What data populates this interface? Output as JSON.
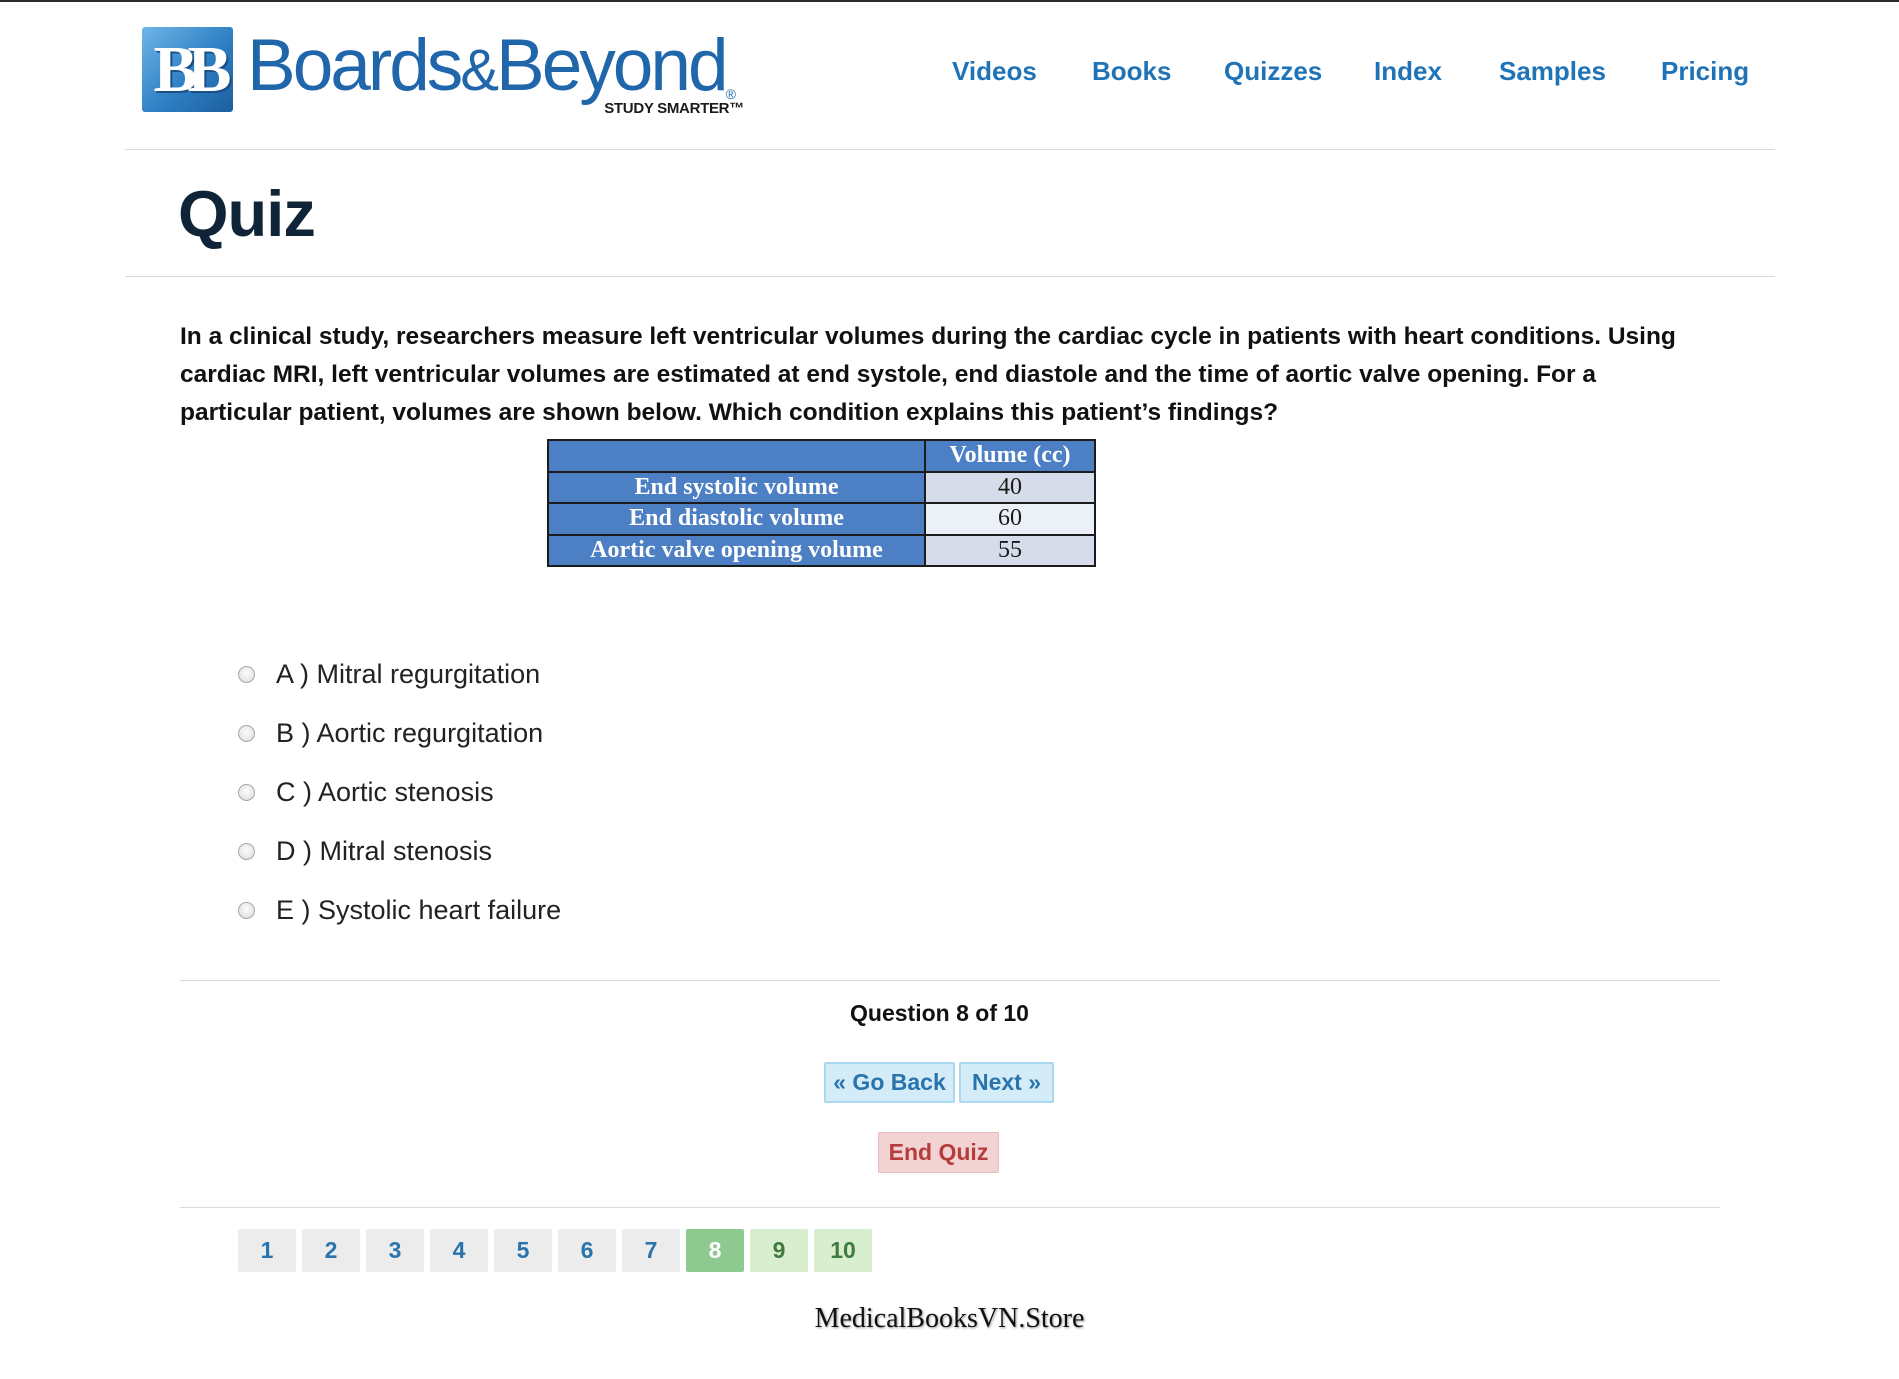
{
  "brand": {
    "badge_text": "BB",
    "word_left": "Boards",
    "word_amp": "&",
    "word_right": "Beyond",
    "registered": "®",
    "tagline": "STUDY SMARTER™"
  },
  "nav": {
    "items": [
      {
        "label": "Videos"
      },
      {
        "label": "Books"
      },
      {
        "label": "Quizzes"
      },
      {
        "label": "Index"
      },
      {
        "label": "Samples"
      },
      {
        "label": "Pricing"
      }
    ]
  },
  "page": {
    "title": "Quiz"
  },
  "question": {
    "text": "In a clinical study, researchers measure left ventricular volumes during the cardiac cycle in patients with heart conditions. Using cardiac MRI, left ventricular volumes are estimated at end systole, end diastole and the time of aortic valve opening. For a particular patient, volumes are shown below. Which condition explains this patient’s findings?",
    "table": {
      "header": "Volume (cc)",
      "rows": [
        {
          "label": "End systolic volume",
          "value": "40"
        },
        {
          "label": "End diastolic volume",
          "value": "60"
        },
        {
          "label": "Aortic valve opening volume",
          "value": "55"
        }
      ]
    },
    "options": [
      {
        "label": "A ) Mitral regurgitation"
      },
      {
        "label": "B ) Aortic regurgitation"
      },
      {
        "label": "C ) Aortic stenosis"
      },
      {
        "label": "D ) Mitral stenosis"
      },
      {
        "label": "E ) Systolic heart failure"
      }
    ]
  },
  "progress": {
    "text": "Question 8 of 10"
  },
  "controls": {
    "back_label": "« Go Back",
    "next_label": "Next »",
    "end_label": "End Quiz"
  },
  "pager": {
    "pages": [
      "1",
      "2",
      "3",
      "4",
      "5",
      "6",
      "7",
      "8",
      "9",
      "10"
    ],
    "current": "8"
  },
  "watermark": {
    "text": "MedicalBooksVN.Store"
  }
}
